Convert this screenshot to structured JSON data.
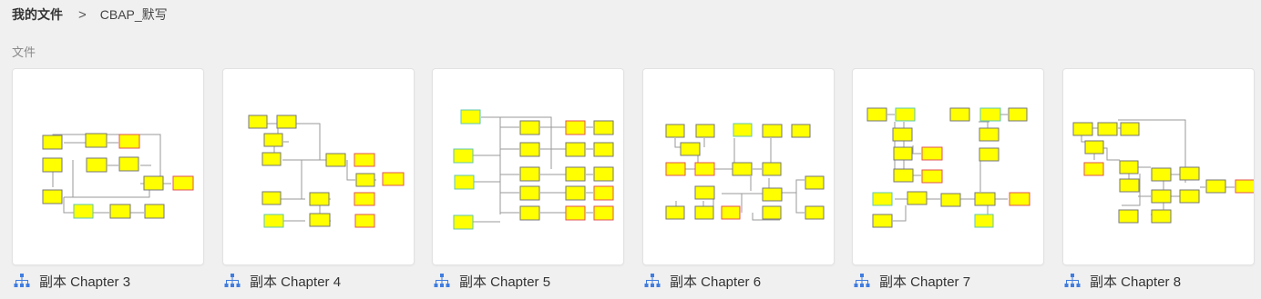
{
  "breadcrumb": {
    "root": "我的文件",
    "separator": ">",
    "current": "CBAP_默写"
  },
  "section_label": "文件",
  "colors": {
    "node_fill": "#ffff00",
    "node_border": "#777777",
    "accent_red": "#e05555",
    "accent_teal": "#5fc7b0",
    "icon_blue": "#3f7de0"
  },
  "files": [
    {
      "name": "副本 Chapter 3",
      "icon": "mindmap-icon"
    },
    {
      "name": "副本 Chapter 4",
      "icon": "mindmap-icon"
    },
    {
      "name": "副本 Chapter 5",
      "icon": "mindmap-icon"
    },
    {
      "name": "副本 Chapter 6",
      "icon": "mindmap-icon"
    },
    {
      "name": "副本 Chapter 7",
      "icon": "mindmap-icon"
    },
    {
      "name": "副本 Chapter 8",
      "icon": "mindmap-icon"
    }
  ]
}
